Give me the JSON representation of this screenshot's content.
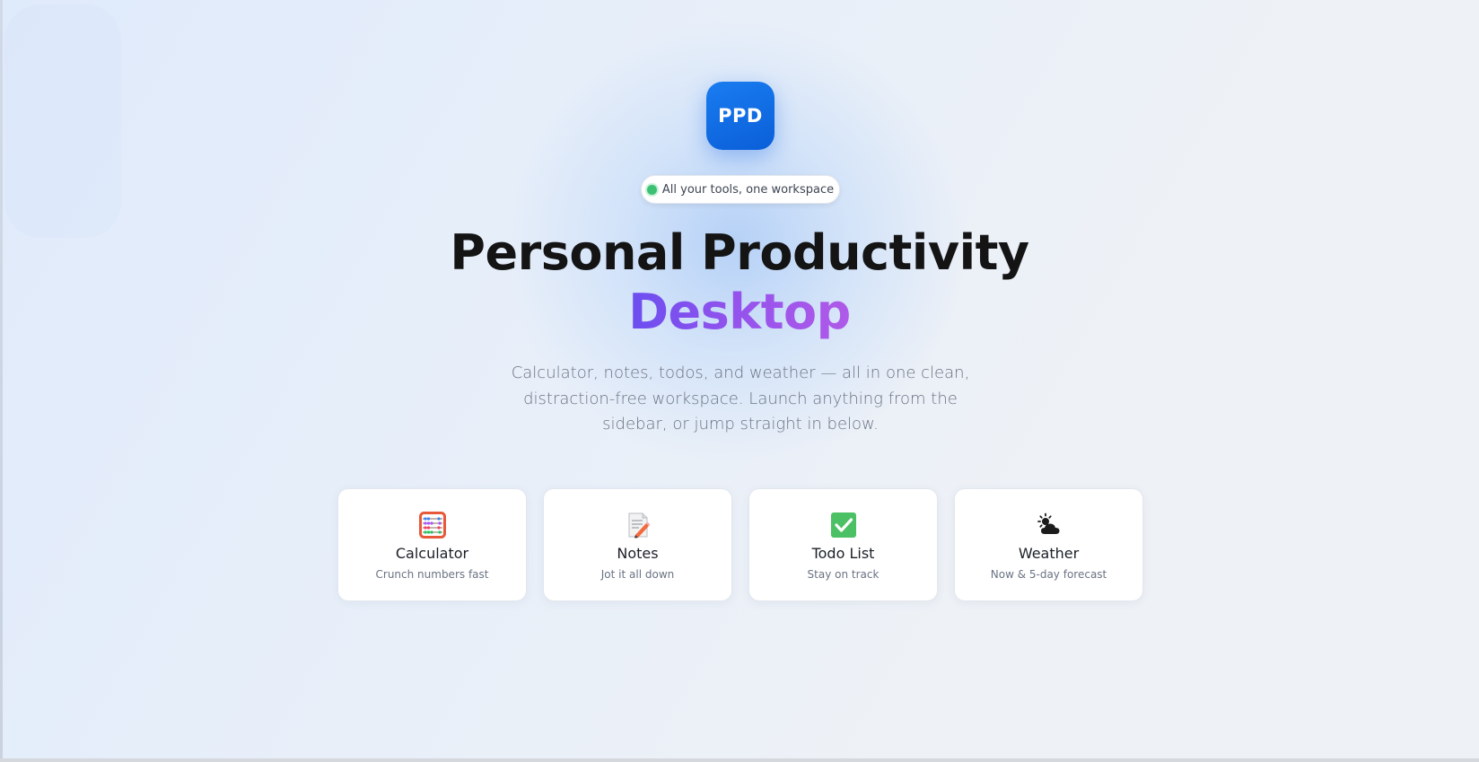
{
  "logo": {
    "text": "PPD"
  },
  "tagline": {
    "text": "All your tools, one workspace"
  },
  "hero": {
    "title_line1": "Personal Productivity",
    "title_line2": "Desktop",
    "subtitle": "Calculator, notes, todos, and weather — all in one clean, distraction-free workspace. Launch anything from the sidebar, or jump straight in below."
  },
  "cards": [
    {
      "title": "Calculator",
      "desc": "Crunch numbers fast",
      "icon": "abacus-icon"
    },
    {
      "title": "Notes",
      "desc": "Jot it all down",
      "icon": "memo-icon"
    },
    {
      "title": "Todo List",
      "desc": "Stay on track",
      "icon": "check-box-icon"
    },
    {
      "title": "Weather",
      "desc": "Now & 5-day forecast",
      "icon": "sun-behind-cloud-icon"
    }
  ],
  "colors": {
    "logo_blue": "#0a5fd8",
    "accent_purple": "#9553ec",
    "status_green": "#3cc173"
  }
}
